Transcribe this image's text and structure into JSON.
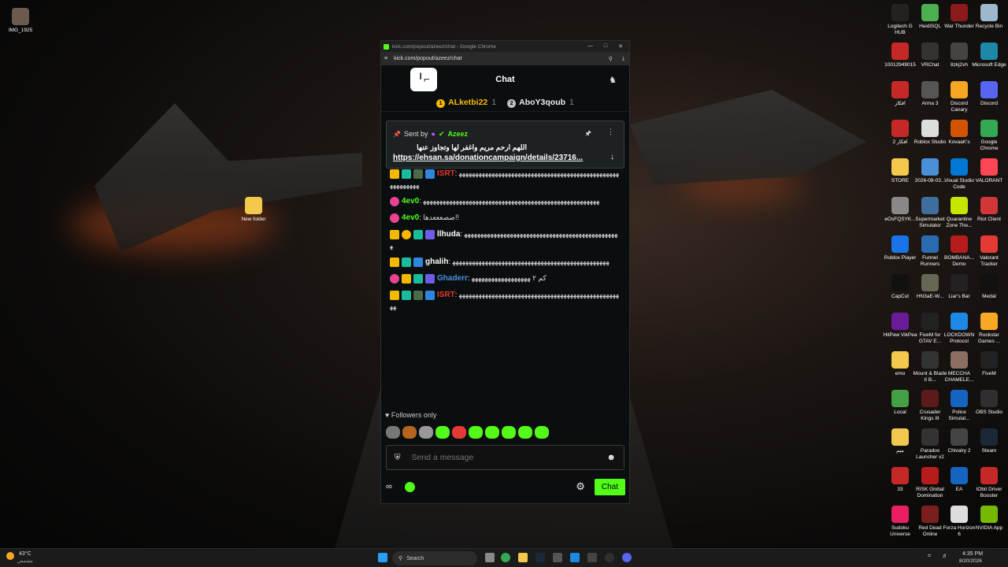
{
  "desktop": {
    "left_icons": [
      {
        "label": "IMG_1925",
        "icon": "image-icon",
        "color": "#6a5a50"
      },
      {
        "label": "New folder",
        "icon": "folder-icon",
        "color": "#f2c94c"
      }
    ],
    "right_icons": [
      {
        "label": "Logitech G HUB",
        "icon": "logitech-icon",
        "color": "#222222"
      },
      {
        "label": "HeidiSQL",
        "icon": "heidisql-icon",
        "color": "#4caf50"
      },
      {
        "label": "War Thunder",
        "icon": "warthunder-icon",
        "color": "#8b1a1a"
      },
      {
        "label": "Recycle Bin",
        "icon": "recycle-bin-icon",
        "color": "#9eb7cc"
      },
      {
        "label": "10012949015",
        "icon": "pdf-icon",
        "color": "#c62828"
      },
      {
        "label": "VRChat",
        "icon": "vrchat-icon",
        "color": "#333333"
      },
      {
        "label": "8zkj2vh",
        "icon": "image-icon",
        "color": "#444444"
      },
      {
        "label": "Microsoft Edge",
        "icon": "edge-icon",
        "color": "#1e88a8"
      },
      {
        "label": "افكار",
        "icon": "pdf-icon",
        "color": "#c62828"
      },
      {
        "label": "Arma 3",
        "icon": "arma-icon",
        "color": "#555555"
      },
      {
        "label": "Discord Canary",
        "icon": "discord-canary-icon",
        "color": "#f5a623"
      },
      {
        "label": "Discord",
        "icon": "discord-icon",
        "color": "#5865f2"
      },
      {
        "label": "افكار 2",
        "icon": "pdf-icon",
        "color": "#c62828"
      },
      {
        "label": "Roblox Studio",
        "icon": "roblox-studio-icon",
        "color": "#dddddd"
      },
      {
        "label": "KovaaK's",
        "icon": "kovaaks-icon",
        "color": "#d35400"
      },
      {
        "label": "Google Chrome",
        "icon": "chrome-icon",
        "color": "#34a853"
      },
      {
        "label": "STORE",
        "icon": "folder-icon",
        "color": "#f2c94c"
      },
      {
        "label": "2026-08-03...",
        "icon": "file-icon",
        "color": "#4a90d9"
      },
      {
        "label": "Visual Studio Code",
        "icon": "vscode-icon",
        "color": "#0078d4"
      },
      {
        "label": "VALORANT",
        "icon": "valorant-icon",
        "color": "#ff4655"
      },
      {
        "label": "eOsFQSYK...",
        "icon": "file-icon",
        "color": "#888888"
      },
      {
        "label": "Supermarket Simulator",
        "icon": "supermarket-icon",
        "color": "#3d6e9e"
      },
      {
        "label": "Quarantine Zone The...",
        "icon": "quarantine-icon",
        "color": "#c6e600"
      },
      {
        "label": "Riot Client",
        "icon": "riot-icon",
        "color": "#d13639"
      },
      {
        "label": "Roblox Player",
        "icon": "roblox-icon",
        "color": "#1a73e8"
      },
      {
        "label": "Funnel Runners",
        "icon": "funnel-icon",
        "color": "#2b6cb0"
      },
      {
        "label": "BOMBANA... Demo",
        "icon": "bombana-icon",
        "color": "#b71c1c"
      },
      {
        "label": "Valorant Tracker",
        "icon": "tracker-icon",
        "color": "#e53935"
      },
      {
        "label": "CapCut",
        "icon": "capcut-icon",
        "color": "#111111"
      },
      {
        "label": "HN3aE-W...",
        "icon": "image-icon",
        "color": "#666655"
      },
      {
        "label": "Liar's Bar",
        "icon": "liars-bar-icon",
        "color": "#222222"
      },
      {
        "label": "Medal",
        "icon": "medal-icon",
        "color": "#111111"
      },
      {
        "label": "HitPaw VikPea",
        "icon": "hitpaw-icon",
        "color": "#6a1b9a"
      },
      {
        "label": "FiveM for GTAV E...",
        "icon": "fivem-icon",
        "color": "#222222"
      },
      {
        "label": "LOCKDOWN Protocol",
        "icon": "lockdown-icon",
        "color": "#1e88e5"
      },
      {
        "label": "Rockstar Games ...",
        "icon": "rockstar-icon",
        "color": "#f9a825"
      },
      {
        "label": "emo",
        "icon": "folder-icon",
        "color": "#f2c94c"
      },
      {
        "label": "Mount & Blade II B...",
        "icon": "bannerlord-icon",
        "color": "#333333"
      },
      {
        "label": "MECCHA CHAMELE...",
        "icon": "meccha-icon",
        "color": "#8d6e63"
      },
      {
        "label": "FiveM",
        "icon": "fivem-icon",
        "color": "#222222"
      },
      {
        "label": "Local",
        "icon": "local-icon",
        "color": "#43a047"
      },
      {
        "label": "Crusader Kings III",
        "icon": "ck3-icon",
        "color": "#5d1a1a"
      },
      {
        "label": "Police Simulat...",
        "icon": "police-icon",
        "color": "#1565c0"
      },
      {
        "label": "OBS Studio",
        "icon": "obs-icon",
        "color": "#302e31"
      },
      {
        "label": "ميم",
        "icon": "folder-icon",
        "color": "#f2c94c"
      },
      {
        "label": "Paradox Launcher v2",
        "icon": "paradox-icon",
        "color": "#333333"
      },
      {
        "label": "Chivalry 2",
        "icon": "chivalry-icon",
        "color": "#444444"
      },
      {
        "label": "Steam",
        "icon": "steam-icon",
        "color": "#1b2838"
      },
      {
        "label": "33",
        "icon": "pdf-icon",
        "color": "#c62828"
      },
      {
        "label": "RISK Global Domination",
        "icon": "risk-icon",
        "color": "#b71c1c"
      },
      {
        "label": "EA",
        "icon": "ea-icon",
        "color": "#1565c0"
      },
      {
        "label": "IObit Driver Booster",
        "icon": "iobit-icon",
        "color": "#c62828"
      },
      {
        "label": "Sudoku Universe",
        "icon": "sudoku-icon",
        "color": "#e91e63"
      },
      {
        "label": "Red Dead Online",
        "icon": "rdo-icon",
        "color": "#7b1e1e"
      },
      {
        "label": "Forza Horizon 6",
        "icon": "forza-icon",
        "color": "#dddddd"
      },
      {
        "label": "NVIDIA App",
        "icon": "nvidia-icon",
        "color": "#76b900"
      }
    ]
  },
  "browser": {
    "title": "kick.com/popout/azeez/chat - Google Chrome",
    "url": "kick.com/popout/azeez/chat"
  },
  "chat": {
    "logo": "╵⌐",
    "title": "Chat",
    "leaders": [
      {
        "rank": "1",
        "name": "ALketbi22",
        "count": "1",
        "color": "#f5b800"
      },
      {
        "rank": "2",
        "name": "AboY3qoub",
        "count": "1",
        "color": "#c0c0c0"
      }
    ],
    "pinned": {
      "sent_by": "Sent by",
      "author": "Azeez",
      "text": "اللهم ارحم مريم واغفر لها وتجاوز عنها",
      "link": "https://ehsan.sa/donationcampaign/details/23716..."
    },
    "messages": [
      {
        "user": "ISRT",
        "color": "#e53935",
        "badges": [
          "crown",
          "sub",
          "kick",
          "verified"
        ],
        "text": "ﻬﻬﻬﻬﻬﻬﻬﻬﻬﻬﻬﻬﻬﻬﻬﻬﻬﻬﻬﻬﻬﻬﻬﻬﻬﻬﻬﻬﻬﻬﻬﻬﻬﻬﻬﻬﻬﻬﻬﻬﻬﻬﻬﻬﻬﻬﻬﻬﻬﻬﻬﻬﻬﻬﻬﻬﻬﻬ"
      },
      {
        "user": "4ev0",
        "color": "#53fc18",
        "badges": [
          "pink"
        ],
        "text": "ﻬﻬﻬﻬﻬﻬﻬﻬﻬﻬﻬﻬﻬﻬﻬﻬﻬﻬﻬﻬﻬﻬﻬﻬﻬﻬﻬﻬﻬﻬﻬﻬﻬﻬﻬﻬﻬﻬﻬﻬﻬﻬﻬﻬﻬﻬﻬﻬﻬﻬﻬﻬﻬﻬ"
      },
      {
        "user": "4ev0",
        "color": "#53fc18",
        "badges": [
          "pink"
        ],
        "text": "صصعععدها!!"
      },
      {
        "user": "llhuda",
        "color": "#ffffff",
        "badges": [
          "crown",
          "gold1",
          "sub",
          "og"
        ],
        "text": "ﻬﻬﻬﻬﻬﻬﻬﻬﻬﻬﻬﻬﻬﻬﻬﻬﻬﻬﻬﻬﻬﻬﻬﻬﻬﻬﻬﻬﻬﻬﻬﻬﻬﻬﻬﻬﻬﻬﻬﻬﻬﻬﻬﻬﻬﻬﻬﻬ"
      },
      {
        "user": "ghalih",
        "color": "#ffffff",
        "badges": [
          "crown",
          "sub",
          "verified"
        ],
        "text": "ﻬﻬﻬﻬﻬﻬﻬﻬﻬﻬﻬﻬﻬﻬﻬﻬﻬﻬﻬﻬﻬﻬﻬﻬﻬﻬﻬﻬﻬﻬﻬﻬﻬﻬﻬﻬﻬﻬﻬﻬﻬﻬﻬﻬﻬﻬﻬﻬ"
      },
      {
        "user": "Ghaderr",
        "color": "#4a90e2",
        "badges": [
          "pink",
          "crown",
          "sub",
          "og"
        ],
        "text": "كم ٢ ﻬﻬﻬﻬﻬﻬﻬﻬﻬﻬﻬﻬﻬﻬﻬﻬﻬﻬ"
      },
      {
        "user": "ISRT",
        "color": "#e53935",
        "badges": [
          "crown",
          "sub",
          "kick",
          "verified"
        ],
        "text": "ﻬﻬﻬﻬﻬﻬﻬﻬﻬﻬﻬﻬﻬﻬﻬﻬﻬﻬﻬﻬﻬﻬﻬﻬﻬﻬﻬﻬﻬﻬﻬﻬﻬﻬﻬﻬﻬﻬﻬﻬﻬﻬﻬﻬﻬﻬﻬﻬﻬﻬﻬ"
      }
    ],
    "followers_only": "Followers only",
    "emotes": [
      "#777777",
      "#b5651d",
      "#999999",
      "#53fc18",
      "#e53935",
      "#53fc18",
      "#53fc18",
      "#53fc18",
      "#53fc18",
      "#53fc18"
    ],
    "input_placeholder": "Send a message",
    "send_label": "Chat",
    "accent": "#53fc18"
  },
  "taskbar": {
    "weather_temp": "43°C",
    "weather_desc": "مشمس",
    "search_label": "Search",
    "time": "4:35 PM",
    "date": "8/20/2026"
  }
}
